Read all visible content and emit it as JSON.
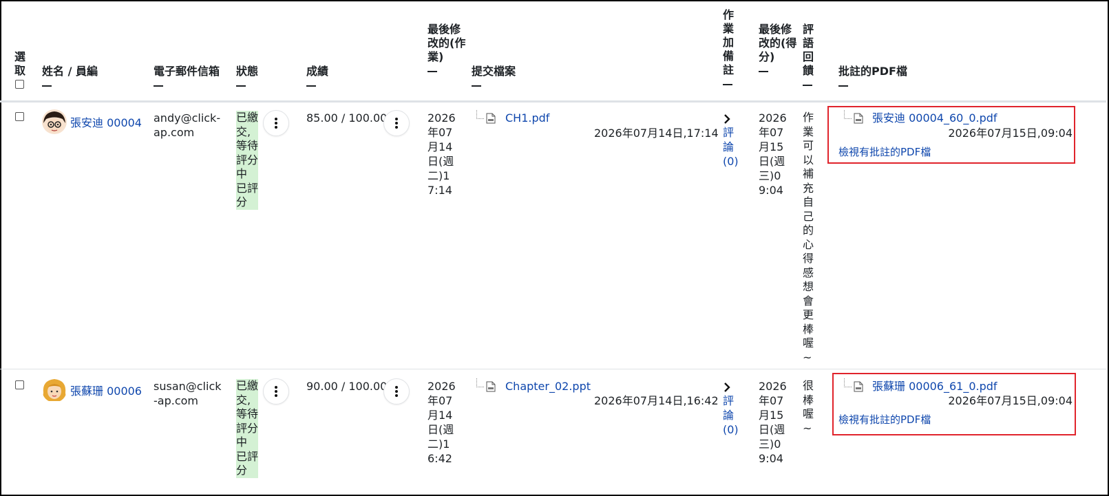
{
  "headers": {
    "select": "選取",
    "name": "姓名 / 員編",
    "email": "電子郵件信箱",
    "status": "狀態",
    "grade": "成績",
    "last_modified_submission": "最後修改的(作業)",
    "files": "提交檔案",
    "comments": "作業加備註",
    "last_modified_grade": "最後修改的(得分)",
    "feedback": "評語回饋",
    "annotated_pdf": "批註的PDF檔"
  },
  "rows": [
    {
      "name": "張安迪 00004",
      "email": "andy@click-ap.com",
      "status_lines": [
        "已繳交,",
        "等待",
        "評分",
        "中",
        "已評",
        "分"
      ],
      "grade": "85.00 / 100.00",
      "submission_date": "2026年07月14日(週二)17:14",
      "file": "CH1.pdf",
      "file_time": "2026年07月14日,17:14",
      "comments_label": "評論(0)",
      "grade_date": "2026年07月15日(週三)09:04",
      "feedback": "作業可以補充自己的心得感想會更棒喔~",
      "annotated_file": "張安迪 00004_60_0.pdf",
      "annotated_time": "2026年07月15日,09:04",
      "view_annotated": "檢視有批註的PDF檔"
    },
    {
      "name": "張蘇珊 00006",
      "email": "susan@click-ap.com",
      "status_lines": [
        "已繳交,",
        "等待",
        "評分",
        "中",
        "已評",
        "分"
      ],
      "grade": "90.00 / 100.00",
      "submission_date": "2026年07月14日(週二)16:42",
      "file": "Chapter_02.ppt",
      "file_time": "2026年07月14日,16:42",
      "comments_label": "評論(0)",
      "grade_date": "2026年07月15日(週三)09:04",
      "feedback": "很棒喔~",
      "annotated_file": "張蘇珊 00006_61_0.pdf",
      "annotated_time": "2026年07月15日,09:04",
      "view_annotated": "檢視有批註的PDF檔"
    }
  ],
  "colors": {
    "status_bg": "#d4f1d4",
    "link": "#0f47ad",
    "highlight_box": "#e0232b"
  }
}
